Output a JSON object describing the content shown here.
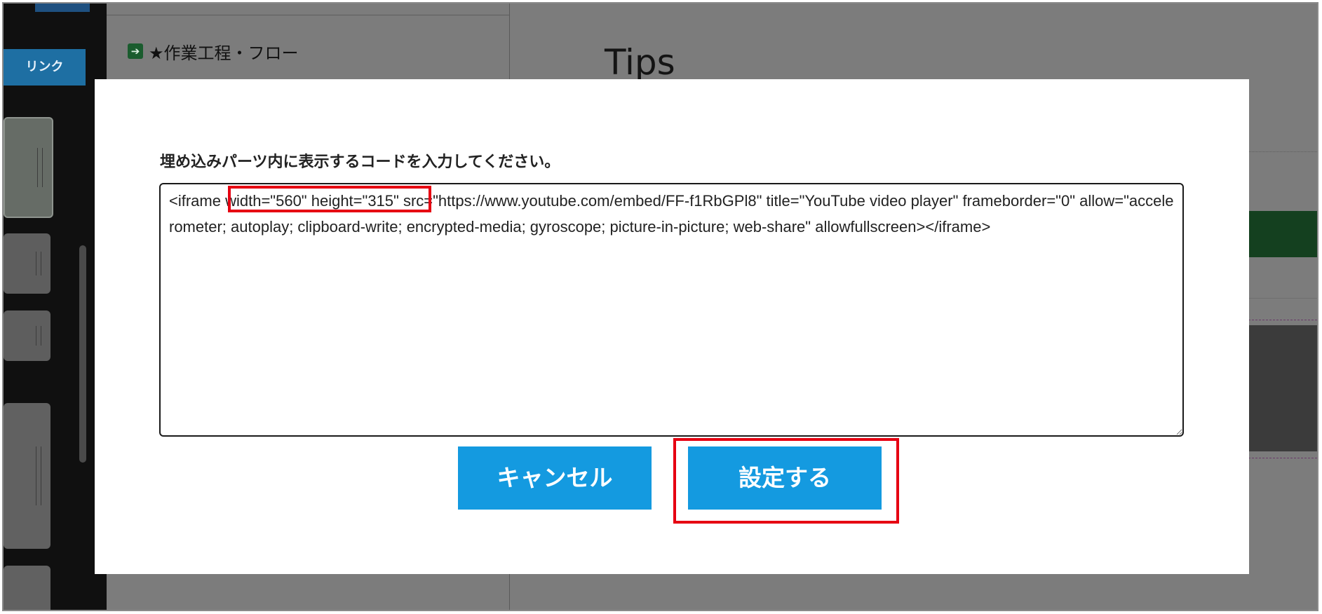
{
  "sidebar": {
    "tab_label": "リンク"
  },
  "middle": {
    "step_icon": "arrow-right-icon",
    "step_label": "★作業工程・フロー"
  },
  "right": {
    "title": "Tips"
  },
  "modal": {
    "prompt": "埋め込みパーツ内に表示するコードを入力してください。",
    "code_value": "<iframe width=\"560\" height=\"315\" src=\"https://www.youtube.com/embed/FF-f1RbGPl8\" title=\"YouTube video player\" frameborder=\"0\" allow=\"accelerometer; autoplay; clipboard-write; encrypted-media; gyroscope; picture-in-picture; web-share\" allowfullscreen></iframe>",
    "cancel_label": "キャンセル",
    "submit_label": "設定する"
  },
  "colors": {
    "button_blue": "#149ae0",
    "highlight_red": "#e60012",
    "overlay_gray": "#7c7c7c"
  }
}
